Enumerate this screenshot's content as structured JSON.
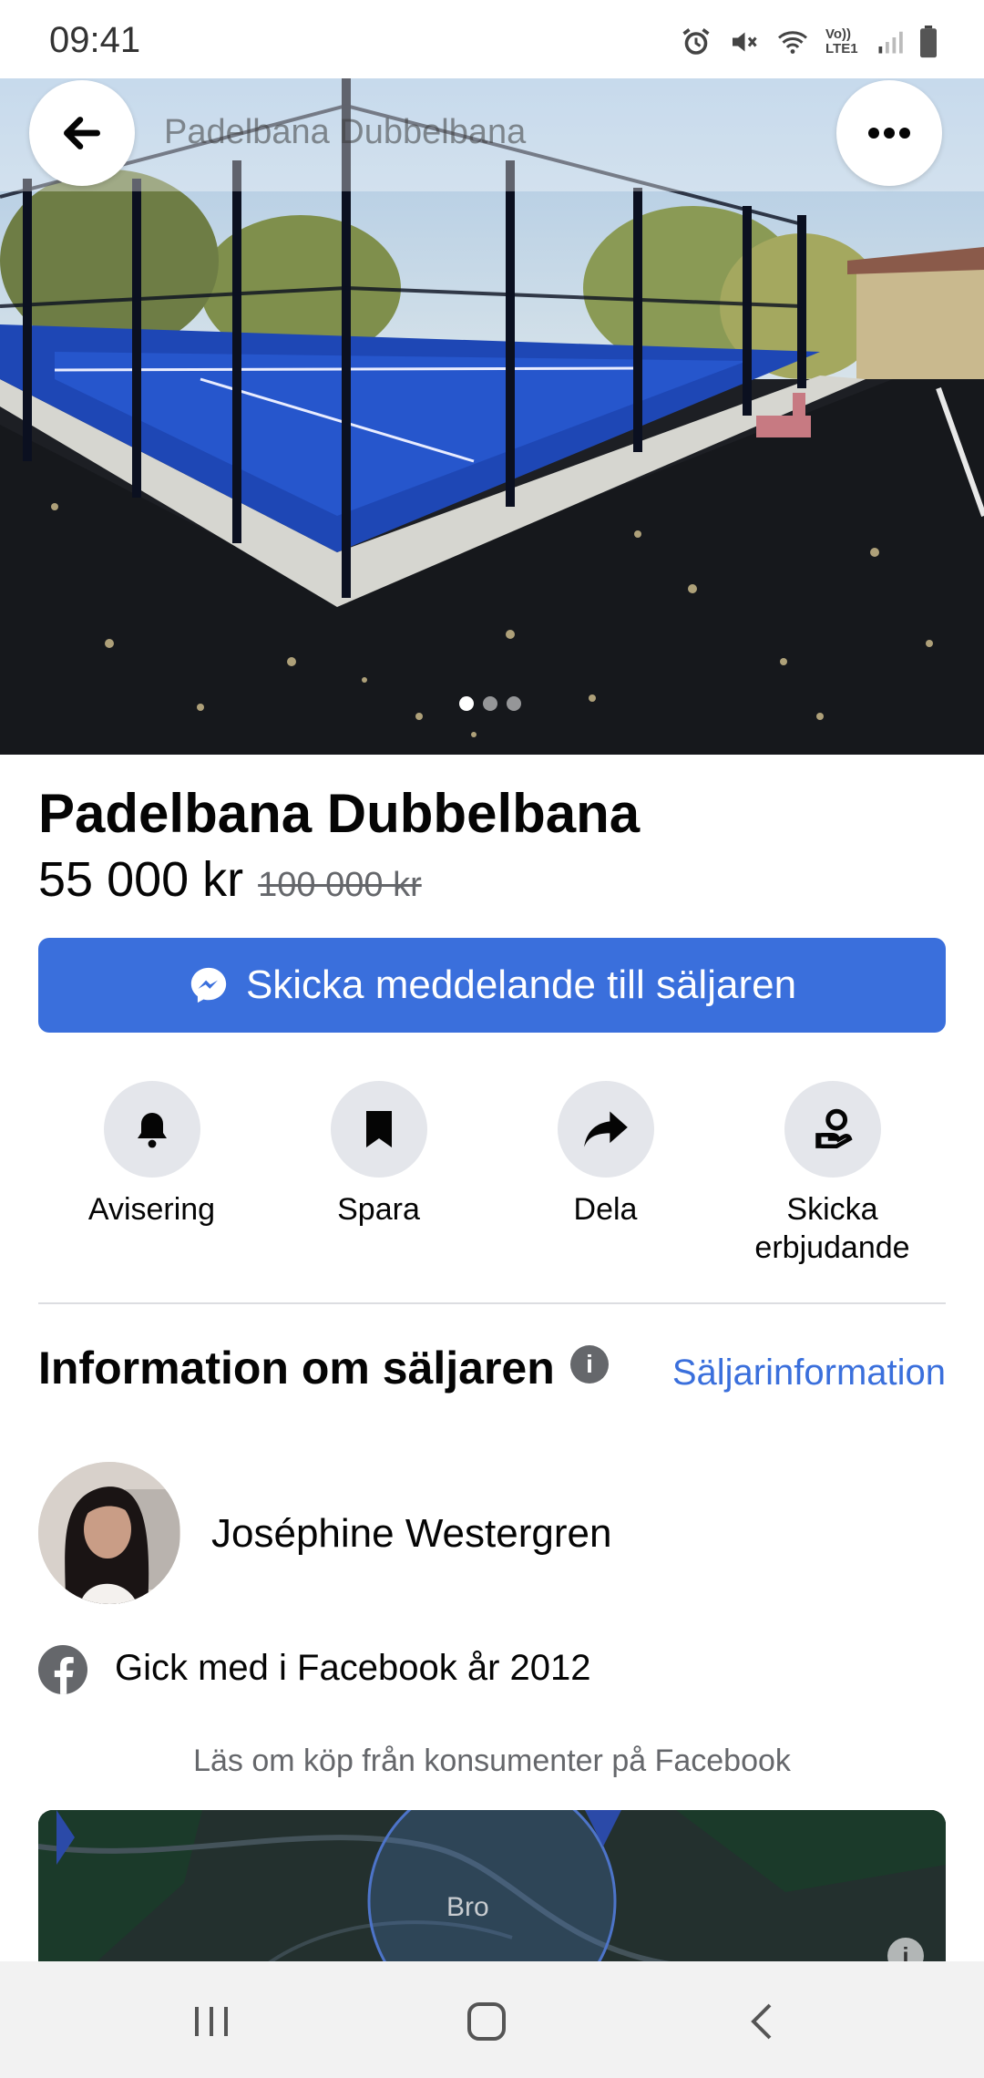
{
  "status_bar": {
    "time": "09:41",
    "network": "Vo)) LTE1"
  },
  "header": {
    "title": "Padelbana Dubbelbana"
  },
  "listing": {
    "title": "Padelbana Dubbelbana",
    "price": "55 000 kr",
    "old_price": "100 000 kr",
    "image_count": 3,
    "active_image": 1
  },
  "cta": {
    "label": "Skicka meddelande till säljaren"
  },
  "actions": [
    {
      "label": "Avisering",
      "icon": "bell-icon"
    },
    {
      "label": "Spara",
      "icon": "bookmark-icon"
    },
    {
      "label": "Dela",
      "icon": "share-icon"
    },
    {
      "label": "Skicka erbjudande",
      "icon": "offer-icon"
    }
  ],
  "seller": {
    "heading": "Information om säljaren",
    "link_label": "Säljarinformation",
    "name": "Joséphine Westergren",
    "joined": "Gick med i Facebook år 2012"
  },
  "learn_more": "Läs om köp från konsumenter på Facebook",
  "map": {
    "label": "Bro"
  },
  "colors": {
    "accent": "#3a6fdc",
    "icon_bg": "#e4e6eb",
    "muted": "#65676b"
  }
}
